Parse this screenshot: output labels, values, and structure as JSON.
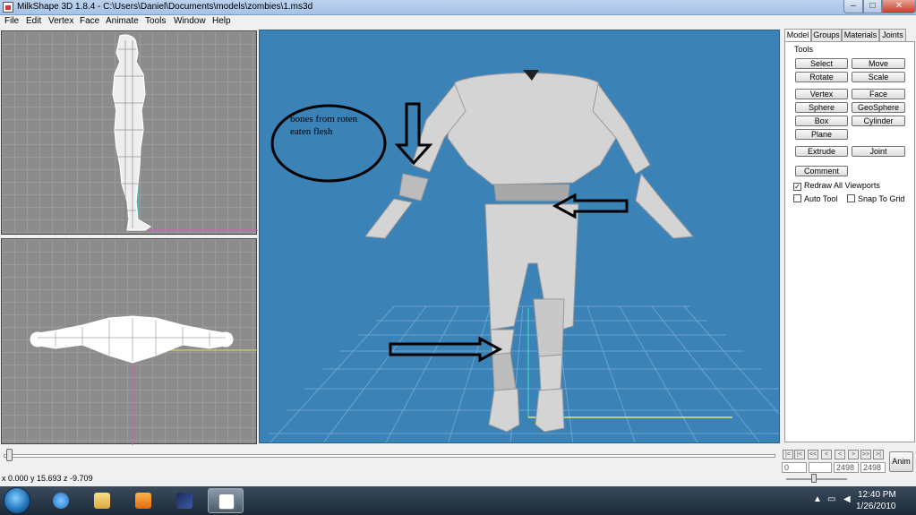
{
  "window": {
    "title": "MilkShape 3D 1.8.4 - C:\\Users\\Daniel\\Documents\\models\\zombies\\1.ms3d",
    "min_glyph": "–",
    "max_glyph": "□",
    "close_glyph": "✕"
  },
  "menu": [
    "File",
    "Edit",
    "Vertex",
    "Face",
    "Animate",
    "Tools",
    "Window",
    "Help"
  ],
  "annotation": {
    "text_line1": "bones from roten",
    "text_line2": "eaten flesh"
  },
  "panel": {
    "tabs": [
      "Model",
      "Groups",
      "Materials",
      "Joints"
    ],
    "tools_label": "Tools",
    "buttons": {
      "select": "Select",
      "move": "Move",
      "rotate": "Rotate",
      "scale": "Scale",
      "vertex": "Vertex",
      "face": "Face",
      "sphere": "Sphere",
      "geosphere": "GeoSphere",
      "box": "Box",
      "cylinder": "Cylinder",
      "plane": "Plane",
      "extrude": "Extrude",
      "joint": "Joint",
      "comment": "Comment"
    },
    "checkboxes": {
      "redraw": {
        "label": "Redraw All Viewports",
        "checked": true
      },
      "auto_tool": {
        "label": "Auto Tool",
        "checked": false
      },
      "snap": {
        "label": "Snap To Grid",
        "checked": false
      }
    }
  },
  "timeline": {
    "nav": [
      "|<",
      "|<",
      "<<",
      "<",
      "<",
      ">",
      ">>",
      ">|",
      ">|"
    ],
    "frame_value": "0",
    "frame_a": "2498",
    "frame_b": "2498",
    "anim_label": "Anim",
    "coords": "x 0.000 y 15.693 z -9.709"
  },
  "taskbar": {
    "time": "12:40 PM",
    "date": "1/26/2010"
  },
  "colors": {
    "viewport_3d": "#3b82b7",
    "viewport_grid": "#8c8c8c"
  }
}
